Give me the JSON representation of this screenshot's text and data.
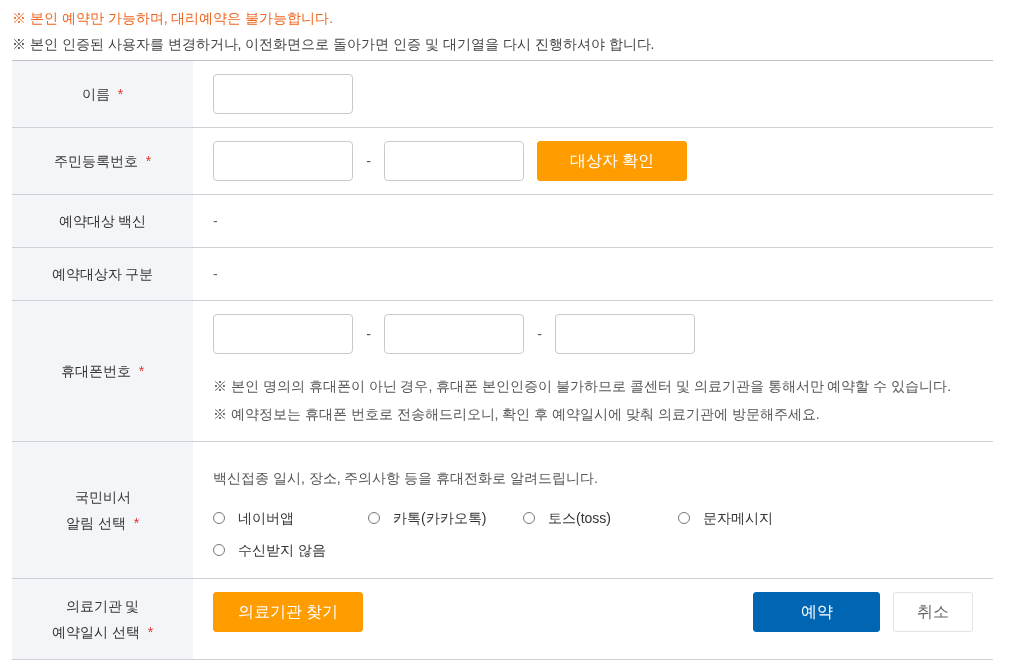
{
  "notices": [
    {
      "text": "※ 본인 예약만 가능하며, 대리예약은 불가능합니다.",
      "kind": "warning"
    },
    {
      "text": "※ 본인 인증된 사용자를 변경하거나, 이전화면으로 돌아가면 인증 및 대기열을 다시 진행하셔야 합니다.",
      "kind": "info"
    }
  ],
  "form": {
    "rows": [
      {
        "kind": "single_input",
        "label": [
          "이름"
        ],
        "required_mark": "*"
      },
      {
        "kind": "split_input",
        "label": [
          "주민등록번호"
        ],
        "required_mark": "*",
        "separators": [
          "-"
        ],
        "button": {
          "label": "대상자 확인",
          "kind": "accent"
        }
      },
      {
        "kind": "value",
        "label": [
          "예약대상 백신"
        ],
        "value": "-"
      },
      {
        "kind": "value",
        "label": [
          "예약대상자 구분"
        ],
        "value": "-"
      },
      {
        "kind": "split_input",
        "label": [
          "휴대폰번호"
        ],
        "required_mark": "*",
        "separators": [
          "-",
          "-"
        ],
        "notes": [
          "※ 본인 명의의 휴대폰이 아닌 경우, 휴대폰 본인인증이 불가하므로 콜센터 및 의료기관을 통해서만 예약할 수 있습니다.",
          "※ 예약정보는 휴대폰 번호로 전송해드리오니, 확인 후 예약일시에 맞춰 의료기관에 방문해주세요."
        ]
      },
      {
        "kind": "radio_group",
        "label": [
          "국민비서",
          "알림 선택"
        ],
        "required_mark": "*",
        "description": "백신접종 일시, 장소, 주의사항 등을 휴대전화로 알려드립니다.",
        "options": [
          {
            "label": "네이버앱",
            "selected": false
          },
          {
            "label": "카톡(카카오톡)",
            "selected": false
          },
          {
            "label": "토스(toss)",
            "selected": false
          },
          {
            "label": "문자메시지",
            "selected": false
          },
          {
            "label": "수신받지 않음",
            "selected": false
          }
        ]
      },
      {
        "kind": "actions",
        "label": [
          "의료기관 및",
          "예약일시 선택"
        ],
        "required_mark": "*",
        "buttons": [
          {
            "label": "의료기관 찾기",
            "kind": "accent"
          },
          {
            "label": "예약",
            "kind": "primary"
          },
          {
            "label": "취소",
            "kind": "secondary"
          }
        ]
      }
    ]
  }
}
